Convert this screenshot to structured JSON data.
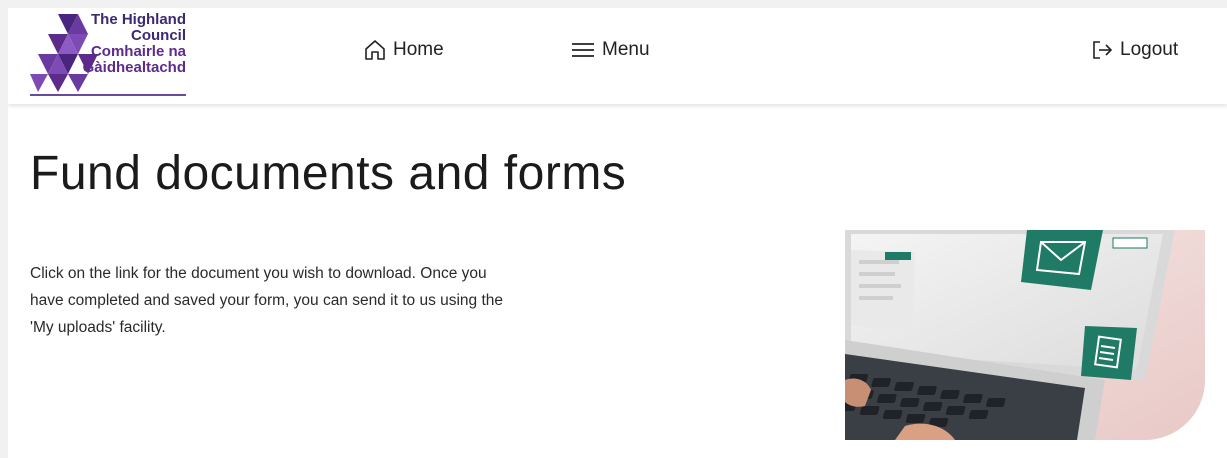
{
  "header": {
    "logo": {
      "line1": "The Highland",
      "line2": "Council",
      "line3": "Comhairle na",
      "line4": "Gàidhealtachd"
    },
    "nav": {
      "home_label": "Home",
      "menu_label": "Menu",
      "logout_label": "Logout"
    }
  },
  "main": {
    "title": "Fund documents and forms",
    "intro_line1": "Click on the link for the document you wish to download. Once you",
    "intro_line2": "have completed and saved your form, you can send it to us using the",
    "intro_line3": "'My uploads' facility."
  },
  "colors": {
    "logo_purple": "#5d2b8a",
    "logo_navy": "#3b2a73",
    "accent_green": "#1f7a66",
    "text": "#1b1b1b"
  },
  "icons": {
    "home": "home-icon",
    "menu": "hamburger-menu-icon",
    "logout": "logout-icon",
    "envelope": "envelope-icon",
    "document": "document-icon"
  }
}
